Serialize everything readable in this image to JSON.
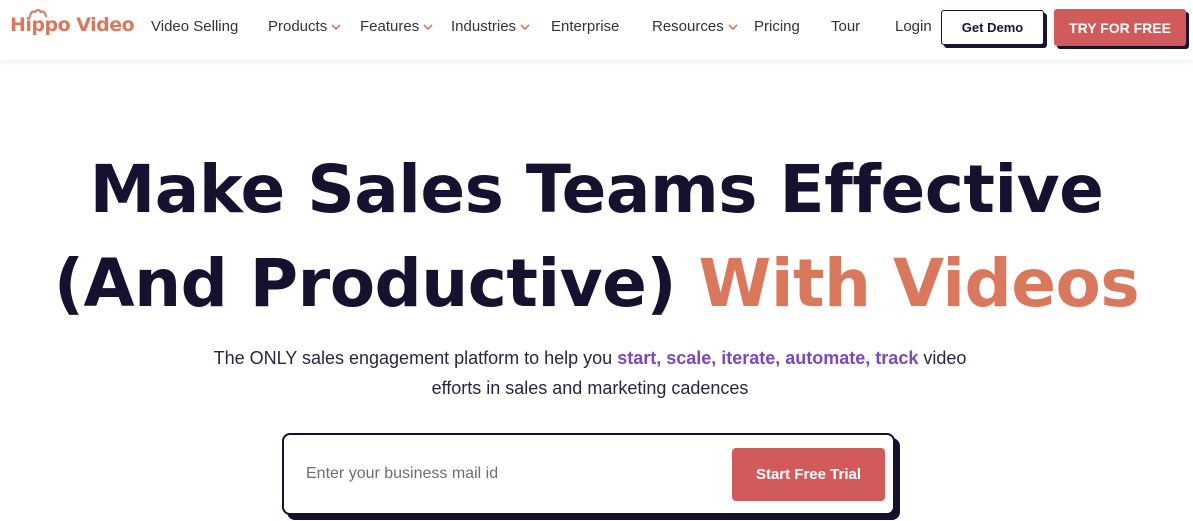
{
  "brand": {
    "name": "Hippo Video",
    "accent_color": "#d9785c",
    "cta_color": "#d15a5a"
  },
  "nav": {
    "items": [
      {
        "label": "Video Selling",
        "has_dropdown": false
      },
      {
        "label": "Products",
        "has_dropdown": true
      },
      {
        "label": "Features",
        "has_dropdown": true
      },
      {
        "label": "Industries",
        "has_dropdown": true
      },
      {
        "label": "Enterprise",
        "has_dropdown": false
      },
      {
        "label": "Resources",
        "has_dropdown": true
      },
      {
        "label": "Pricing",
        "has_dropdown": false
      },
      {
        "label": "Tour",
        "has_dropdown": false
      },
      {
        "label": "Login",
        "has_dropdown": false
      }
    ],
    "get_demo_label": "Get Demo",
    "try_free_label": "TRY FOR FREE"
  },
  "hero": {
    "title_line1": "Make Sales Teams Effective",
    "title_line2_plain": "(And Productive)",
    "title_line2_accent": "With Videos",
    "subtitle_pre": "The ONLY sales engagement platform to help you",
    "subtitle_highlight": "start, scale, iterate, automate, track",
    "subtitle_post": "video efforts in sales and marketing cadences",
    "highlight_color": "#7b47c2"
  },
  "signup": {
    "email_placeholder": "Enter your business mail id",
    "email_value": "",
    "submit_label": "Start Free Trial"
  }
}
